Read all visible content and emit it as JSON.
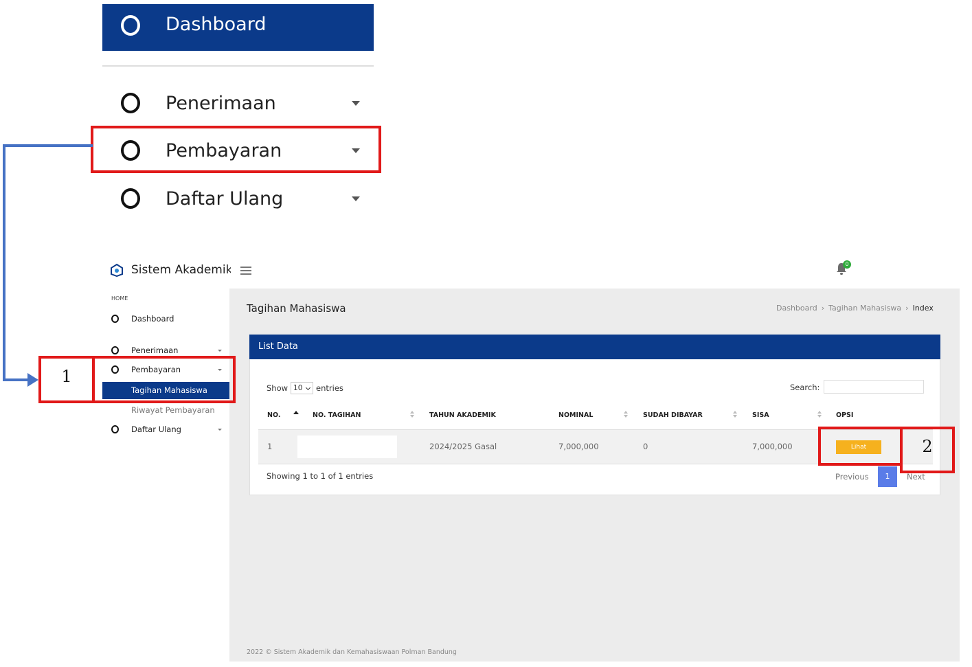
{
  "zoom_menu": {
    "dashboard": "Dashboard",
    "items": [
      {
        "label": "Penerimaan"
      },
      {
        "label": "Pembayaran"
      },
      {
        "label": "Daftar Ulang"
      }
    ]
  },
  "annotations": {
    "step1": "1",
    "step2": "2"
  },
  "app": {
    "title": "Sistem Akademik",
    "notification_count": "0"
  },
  "sidebar": {
    "section": "HOME",
    "items": [
      {
        "label": "Dashboard"
      },
      {
        "label": "Penerimaan"
      },
      {
        "label": "Pembayaran"
      },
      {
        "label": "Daftar Ulang"
      }
    ],
    "submenu": [
      {
        "label": "Tagihan Mahasiswa",
        "active": true
      },
      {
        "label": "Riwayat Pembayaran"
      }
    ]
  },
  "page": {
    "title": "Tagihan Mahasiswa",
    "breadcrumb": [
      "Dashboard",
      "Tagihan Mahasiswa",
      "Index"
    ]
  },
  "card": {
    "title": "List Data",
    "show_prefix": "Show",
    "show_value": "10",
    "show_suffix": "entries",
    "search_label": "Search:",
    "search_value": "",
    "columns": [
      "NO.",
      "NO. TAGIHAN",
      "TAHUN AKADEMIK",
      "NOMINAL",
      "SUDAH DIBAYAR",
      "SISA",
      "OPSI"
    ],
    "rows": [
      {
        "no": "1",
        "no_tagihan": "",
        "tahun_akademik": "2024/2025 Gasal",
        "nominal": "7,000,000",
        "sudah_dibayar": "0",
        "sisa": "7,000,000",
        "action": "Lihat"
      }
    ],
    "showing": "Showing 1 to 1 of 1 entries",
    "pagination": {
      "previous": "Previous",
      "current": "1",
      "next": "Next"
    }
  },
  "footer": "2022 © Sistem Akademik dan Kemahasiswaan Polman Bandung",
  "colors": {
    "primary": "#0b3a8a",
    "annotation_red": "#e11919",
    "connector_blue": "#4672c4",
    "button_warning": "#f6b11e",
    "pagination_active": "#5a7ce8",
    "badge_green": "#2eaa3a"
  }
}
